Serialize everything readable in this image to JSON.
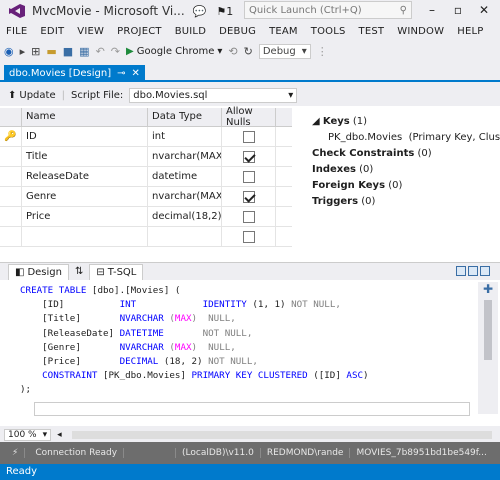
{
  "window": {
    "title": "MvcMovie - Microsoft Vi...",
    "notification_count": "1",
    "quick_launch_placeholder": "Quick Launch (Ctrl+Q)"
  },
  "menu": [
    "FILE",
    "EDIT",
    "VIEW",
    "PROJECT",
    "BUILD",
    "DEBUG",
    "TEAM",
    "TOOLS",
    "TEST",
    "WINDOW",
    "HELP"
  ],
  "toolbar": {
    "run_target": "Google Chrome",
    "configuration": "Debug"
  },
  "tab": {
    "label": "dbo.Movies [Design]"
  },
  "designer": {
    "update_label": "Update",
    "script_file_label": "Script File:",
    "script_file_value": "dbo.Movies.sql"
  },
  "grid": {
    "headers": [
      "Name",
      "Data Type",
      "Allow Nulls"
    ],
    "rows": [
      {
        "name": "ID",
        "type": "int",
        "allow_nulls": false,
        "is_key": true
      },
      {
        "name": "Title",
        "type": "nvarchar(MAX)",
        "allow_nulls": true,
        "is_key": false
      },
      {
        "name": "ReleaseDate",
        "type": "datetime",
        "allow_nulls": false,
        "is_key": false
      },
      {
        "name": "Genre",
        "type": "nvarchar(MAX)",
        "allow_nulls": true,
        "is_key": false
      },
      {
        "name": "Price",
        "type": "decimal(18,2)",
        "allow_nulls": false,
        "is_key": false
      },
      {
        "name": "",
        "type": "",
        "allow_nulls": false,
        "is_key": false
      }
    ]
  },
  "keys_panel": {
    "keys": "Keys",
    "keys_count": "(1)",
    "pk": "PK_dbo.Movies",
    "pk_detail": "(Primary Key, Clus",
    "check": "Check Constraints",
    "check_count": "(0)",
    "indexes": "Indexes",
    "indexes_count": "(0)",
    "fk": "Foreign Keys",
    "fk_count": "(0)",
    "triggers": "Triggers",
    "triggers_count": "(0)"
  },
  "pane_tabs": {
    "design": "Design",
    "tsql": "T-SQL"
  },
  "sql": {
    "l1a": "CREATE TABLE",
    "l1b": " [dbo].[Movies] (",
    "r1a": "    [ID]          ",
    "r1b": "INT",
    "r1c": "            ",
    "r1d": "IDENTITY",
    "r1e": " (1, 1) ",
    "r1f": "NOT NULL,",
    "r2a": "    [Title]       ",
    "r2b": "NVARCHAR",
    "r2c": " (",
    "r2d": "MAX",
    "r2e": ")  ",
    "r2f": "NULL,",
    "r3a": "    [ReleaseDate] ",
    "r3b": "DATETIME",
    "r3c": "       ",
    "r3d": "NOT NULL,",
    "r4a": "    [Genre]       ",
    "r4b": "NVARCHAR",
    "r4c": " (",
    "r4d": "MAX",
    "r4e": ")  ",
    "r4f": "NULL,",
    "r5a": "    [Price]       ",
    "r5b": "DECIMAL",
    "r5c": " (18, 2) ",
    "r5d": "NOT NULL,",
    "r6a": "    CONSTRAINT",
    "r6b": " [PK_dbo.Movies] ",
    "r6c": "PRIMARY KEY CLUSTERED",
    "r6d": " ([ID] ",
    "r6e": "ASC",
    "r6f": ")",
    "end": ");"
  },
  "zoom": "100 %",
  "connection": {
    "state": "Connection Ready",
    "server": "(LocalDB)\\v11.0",
    "user": "REDMOND\\rande",
    "database": "MOVIES_7b8951bd1be549f..."
  },
  "status": {
    "text": "Ready"
  }
}
